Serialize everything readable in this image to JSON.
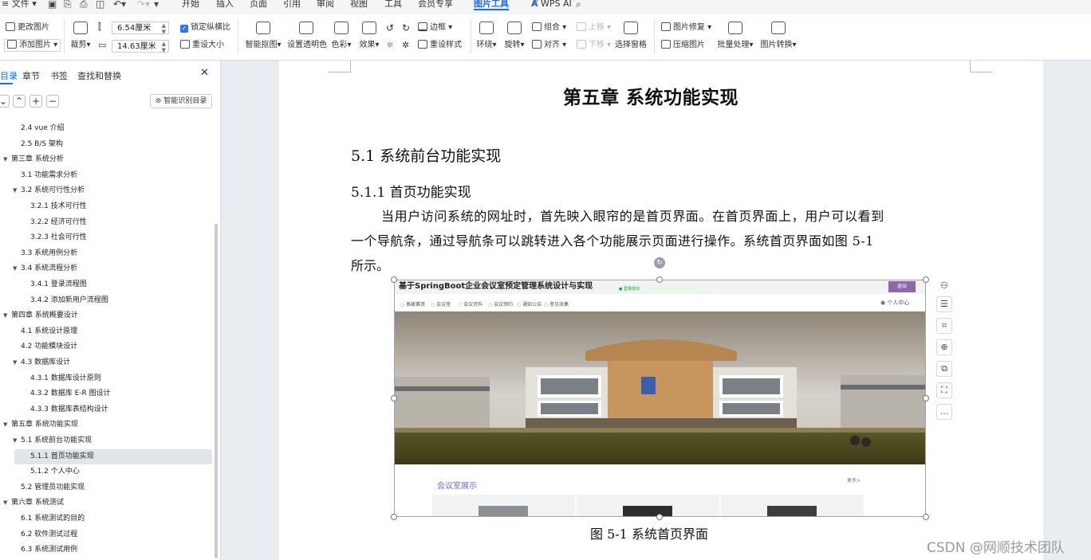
{
  "menubar": {
    "file_label": "文件",
    "tabs": [
      "开始",
      "插入",
      "页面",
      "引用",
      "审阅",
      "视图",
      "工具",
      "会员专享",
      "图片工具"
    ],
    "active_tab": "图片工具",
    "wps_ai": "WPS AI"
  },
  "ribbon": {
    "change_image": "更改图片",
    "add_image": "添加图片",
    "crop": "裁剪",
    "width_value": "6.54厘米",
    "height_value": "14.63厘米",
    "lock_ratio": "锁定纵横比",
    "reset_size": "重设大小",
    "smart_cutout": "智能抠图",
    "set_transparent": "设置透明色",
    "color": "色彩",
    "effect": "效果",
    "border": "边框",
    "reset_style": "重设样式",
    "wrap": "环绕",
    "rotate": "旋转",
    "group": "组合",
    "align": "对齐",
    "bring_forward": "上移",
    "send_backward": "下移",
    "selection_pane": "选择窗格",
    "image_repair": "图片修复",
    "compress_image": "压缩图片",
    "batch_process": "批量处理",
    "image_convert": "图片转换"
  },
  "nav": {
    "tabs": [
      "目录",
      "章节",
      "书签",
      "查找和替换"
    ],
    "smart_toc": "智能识别目录",
    "items": [
      {
        "text": "2.4 vue 介绍",
        "level": 2,
        "arrow": ""
      },
      {
        "text": "2.5 B/S 架构",
        "level": 2,
        "arrow": ""
      },
      {
        "text": "第三章  系统分析",
        "level": 1,
        "arrow": "▼"
      },
      {
        "text": "3.1 功能需求分析",
        "level": 2,
        "arrow": ""
      },
      {
        "text": "3.2 系统可行性分析",
        "level": 2,
        "arrow": "▼"
      },
      {
        "text": "3.2.1 技术可行性",
        "level": 3,
        "arrow": ""
      },
      {
        "text": "3.2.2  经济可行性",
        "level": 3,
        "arrow": ""
      },
      {
        "text": "3.2.3 社会可行性",
        "level": 3,
        "arrow": ""
      },
      {
        "text": "3.3  系统用例分析",
        "level": 2,
        "arrow": ""
      },
      {
        "text": "3.4 系统流程分析",
        "level": 2,
        "arrow": "▼"
      },
      {
        "text": "3.4.1  登录流程图",
        "level": 3,
        "arrow": ""
      },
      {
        "text": "3.4.2  添加新用户流程图",
        "level": 3,
        "arrow": ""
      },
      {
        "text": "第四章  系统概要设计",
        "level": 1,
        "arrow": "▼"
      },
      {
        "text": "4.1 系统设计原理",
        "level": 2,
        "arrow": ""
      },
      {
        "text": "4.2 功能模块设计",
        "level": 2,
        "arrow": ""
      },
      {
        "text": "4.3  数据库设计",
        "level": 2,
        "arrow": "▼"
      },
      {
        "text": "4.3.1 数据库设计原则",
        "level": 3,
        "arrow": ""
      },
      {
        "text": "4.3.2 数据库 E-R 图设计",
        "level": 3,
        "arrow": ""
      },
      {
        "text": "4.3.3 数据库表结构设计",
        "level": 3,
        "arrow": ""
      },
      {
        "text": "第五章  系统功能实现",
        "level": 1,
        "arrow": "▼"
      },
      {
        "text": "5.1 系统前台功能实现",
        "level": 2,
        "arrow": "▼"
      },
      {
        "text": "5.1.1 首页功能实现",
        "level": 3,
        "arrow": ""
      },
      {
        "text": "5.1.2 个人中心",
        "level": 3,
        "arrow": ""
      },
      {
        "text": "5.2 管理员功能实现",
        "level": 2,
        "arrow": ""
      },
      {
        "text": "第六章  系统测试",
        "level": 1,
        "arrow": "▼"
      },
      {
        "text": "6.1 系统测试的目的",
        "level": 2,
        "arrow": ""
      },
      {
        "text": "6.2 软件测试过程",
        "level": 2,
        "arrow": ""
      },
      {
        "text": "6.3 系统测试用例",
        "level": 2,
        "arrow": ""
      }
    ],
    "selected_index": 21
  },
  "document": {
    "chapter_title": "第五章  系统功能实现",
    "h2": "5.1 系统前台功能实现",
    "h3": "5.1.1 首页功能实现",
    "para_lines": [
      "当用户访问系统的网址时，首先映入眼帘的是首页界面。在首页界面上，用户可以看到",
      "一个导航条，通过导航条可以跳转进入各个功能展示页面进行操作。系统首页界面如图 5-1",
      "所示。"
    ],
    "caption": "图 5-1  系统首页界面"
  },
  "figure": {
    "site_title": "基于SpringBoot企业会议室预定管理系统设计与实现",
    "logout": "退出",
    "toast": "登录成功",
    "nav_items": [
      "系统首页",
      "会议室",
      "会议资料",
      "会议预约",
      "通知公告",
      "意见收集"
    ],
    "user": "个人中心",
    "section_title": "会议室展示",
    "more": "更多>"
  },
  "watermark": "CSDN @网顺技术团队",
  "colors": {
    "accent": "#1f6fe5",
    "section_title": "#6b6fd4"
  }
}
